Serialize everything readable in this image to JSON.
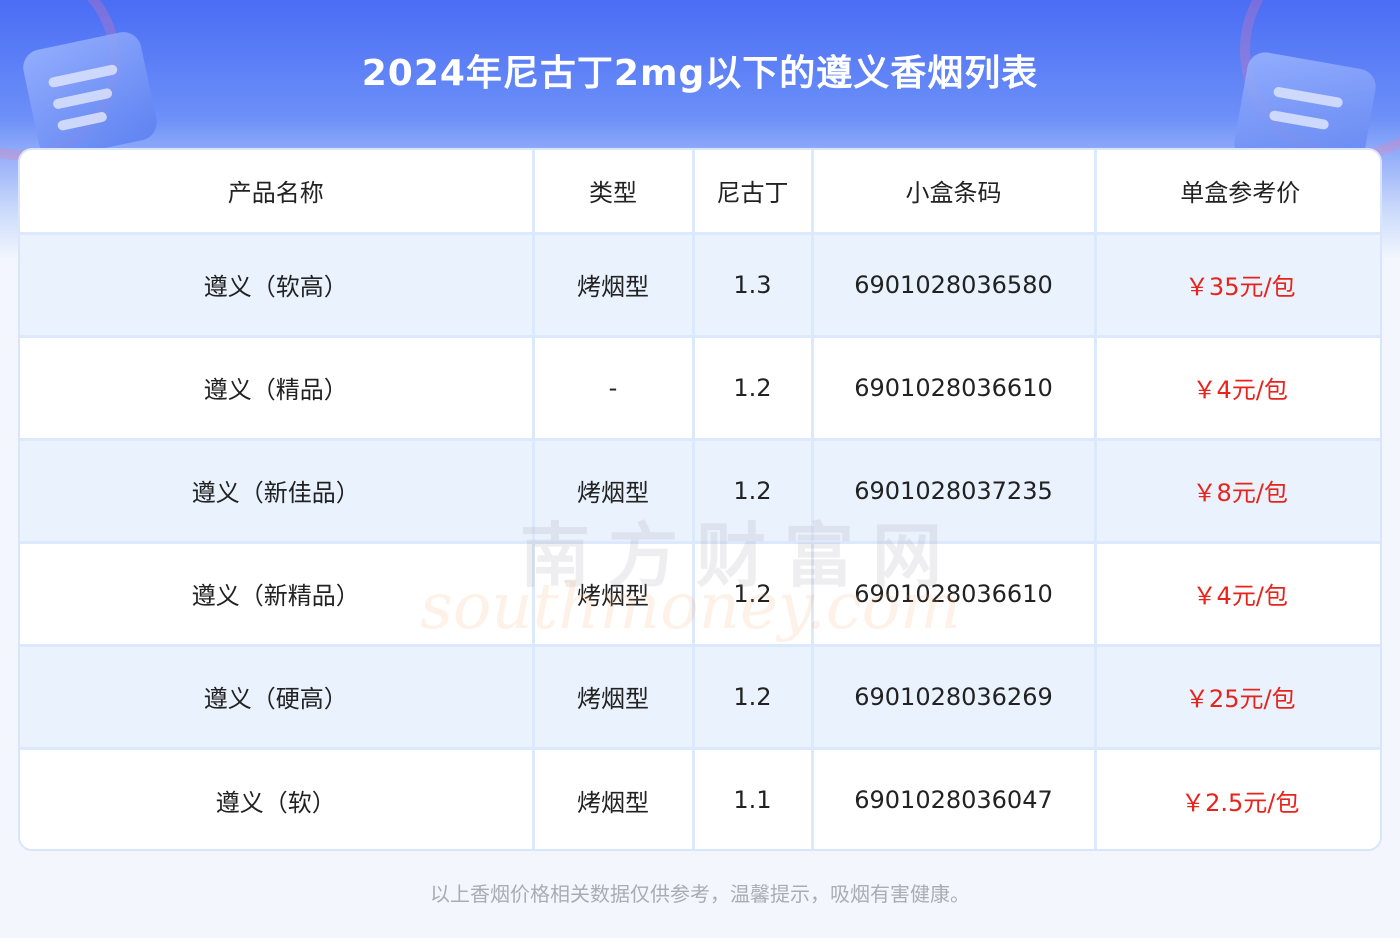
{
  "title": "2024年尼古丁2mg以下的遵义香烟列表",
  "colors": {
    "header_blue": "#4a6df5",
    "price_red": "#e8231c",
    "row_tint": "#e9f2fd",
    "border": "#dce8fb"
  },
  "table": {
    "headers": [
      "产品名称",
      "类型",
      "尼古丁",
      "小盒条码",
      "单盒参考价"
    ],
    "rows": [
      {
        "name": "遵义（软高）",
        "type": "烤烟型",
        "nicotine": "1.3",
        "barcode": "6901028036580",
        "price": "￥35元/包"
      },
      {
        "name": "遵义（精品）",
        "type": "-",
        "nicotine": "1.2",
        "barcode": "6901028036610",
        "price": "￥4元/包"
      },
      {
        "name": "遵义（新佳品）",
        "type": "烤烟型",
        "nicotine": "1.2",
        "barcode": "6901028037235",
        "price": "￥8元/包"
      },
      {
        "name": "遵义（新精品）",
        "type": "烤烟型",
        "nicotine": "1.2",
        "barcode": "6901028036610",
        "price": "￥4元/包"
      },
      {
        "name": "遵义（硬高）",
        "type": "烤烟型",
        "nicotine": "1.2",
        "barcode": "6901028036269",
        "price": "￥25元/包"
      },
      {
        "name": "遵义（软）",
        "type": "烤烟型",
        "nicotine": "1.1",
        "barcode": "6901028036047",
        "price": "￥2.5元/包"
      }
    ]
  },
  "watermark": {
    "cn": "南方财富网",
    "en": "southmoney.com"
  },
  "footer": "以上香烟价格相关数据仅供参考，温馨提示，吸烟有害健康。"
}
